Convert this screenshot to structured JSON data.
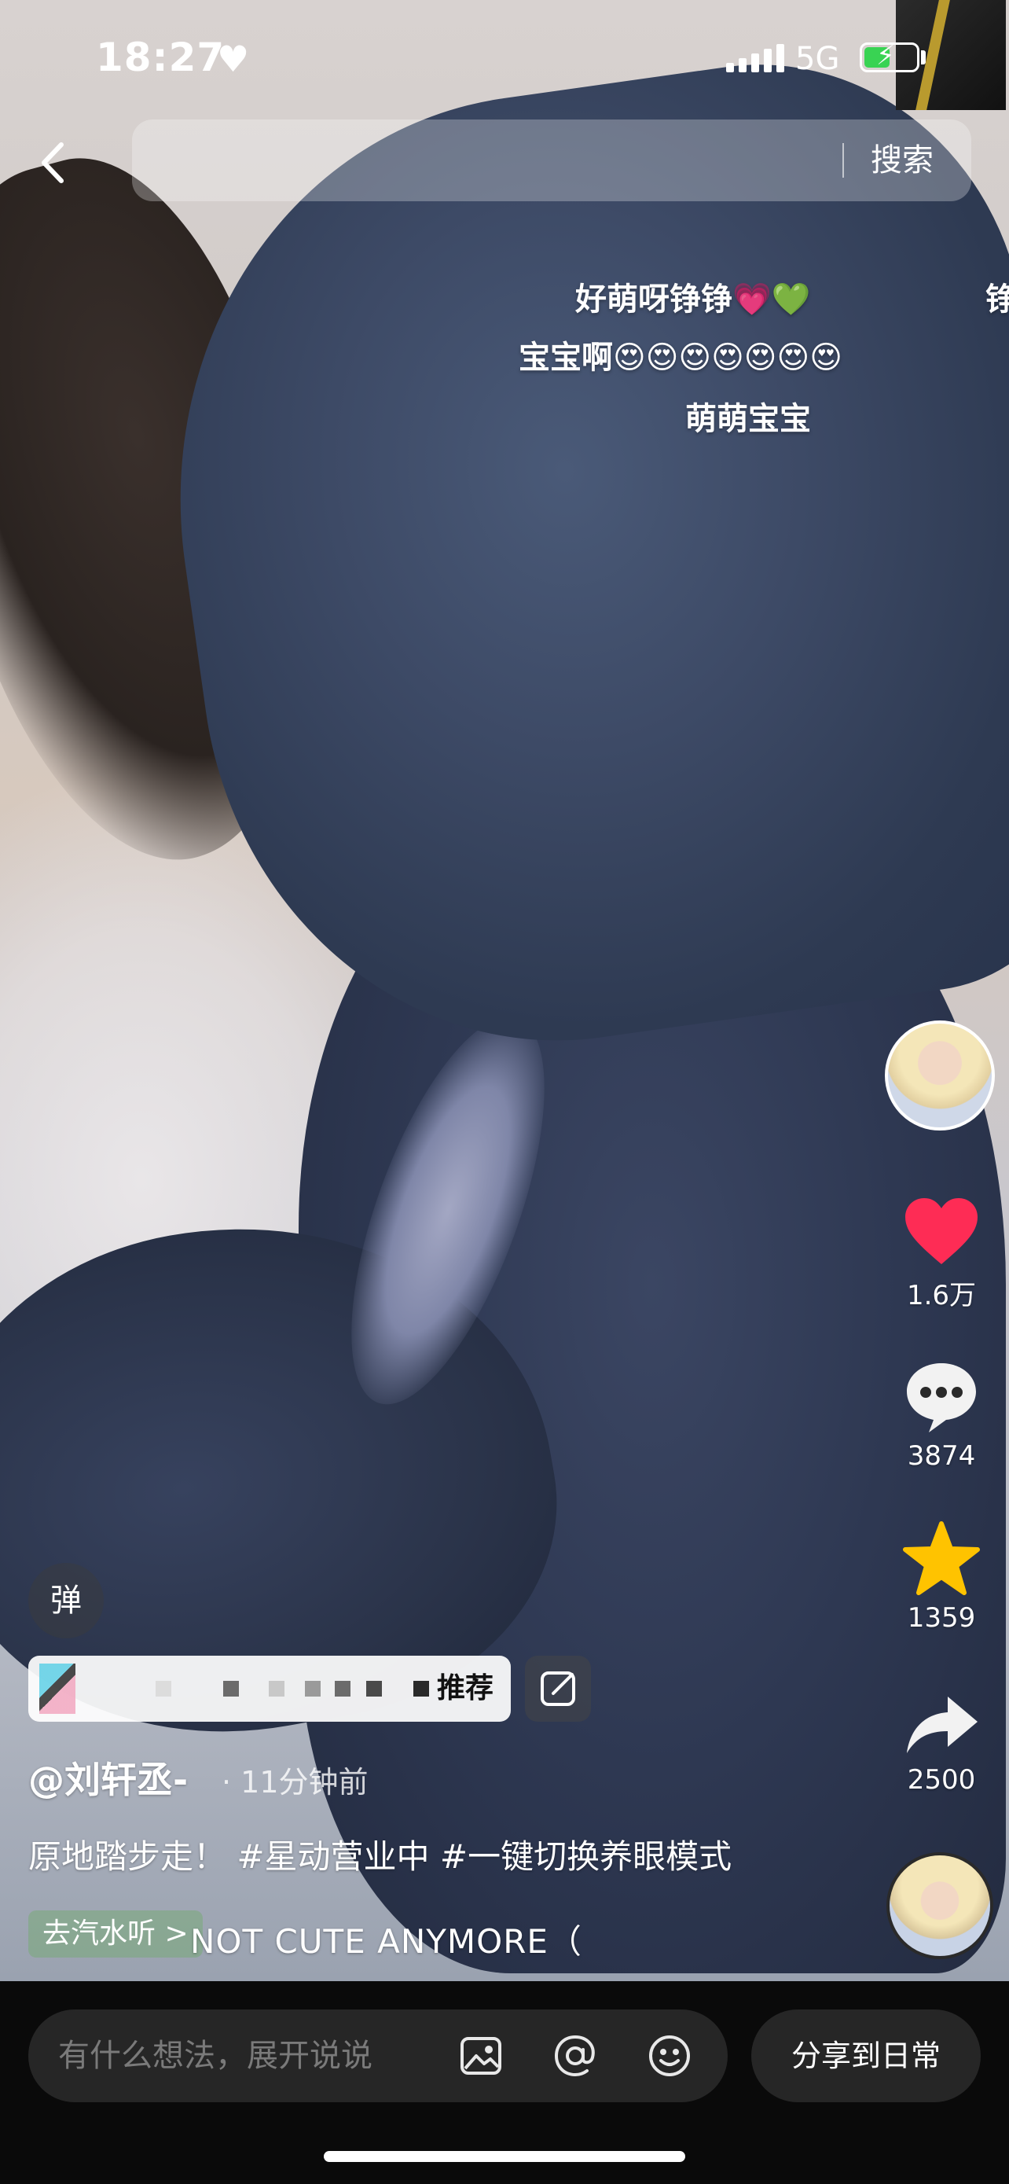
{
  "status_bar": {
    "time": "18:27",
    "network": "5G"
  },
  "search": {
    "button_label": "搜索"
  },
  "danmaku": [
    {
      "text": "好萌呀铮铮💗💚"
    },
    {
      "text": "铮"
    },
    {
      "text": "宝宝啊😍😍😍😍😍😍😍"
    },
    {
      "text": "萌萌宝宝"
    }
  ],
  "actions": {
    "like_count": "1.6万",
    "comment_count": "3874",
    "favorite_count": "1359",
    "share_count": "2500"
  },
  "overlay": {
    "danmaku_toggle": "弹",
    "danmaku_input_label": "推荐",
    "author": "@刘轩丞-",
    "time_ago": "11分钟前",
    "caption": "原地踏步走！ #星动营业中 #一键切换养眼模式",
    "music_tag": "去汽水听 >",
    "music_title": "NOT CUTE ANYMORE（"
  },
  "bottom_bar": {
    "comment_placeholder": "有什么想法，展开说说",
    "share_label": "分享到日常"
  },
  "colors": {
    "like": "#fe2c55",
    "favorite": "#ffc300"
  }
}
